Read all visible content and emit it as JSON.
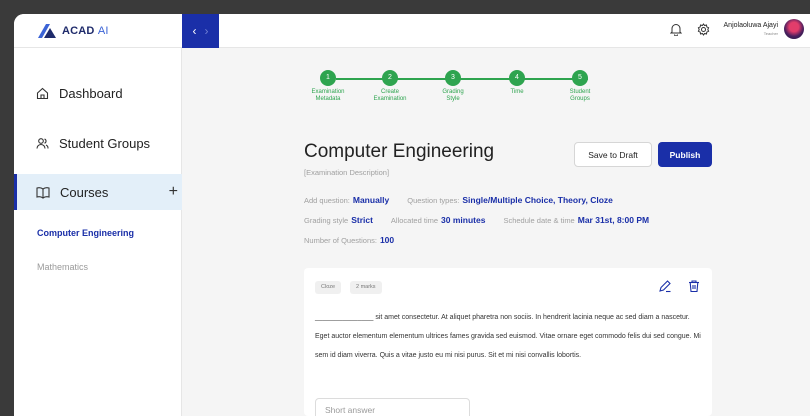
{
  "header": {
    "logo_text": "ACAD",
    "logo_ai": "AI",
    "user_name": "Anjolaoluwa Ajayi",
    "user_role": "Teacher"
  },
  "sidebar": {
    "items": [
      {
        "label": "Dashboard",
        "icon": "home-icon"
      },
      {
        "label": "Student Groups",
        "icon": "users-icon"
      },
      {
        "label": "Courses",
        "icon": "book-icon"
      }
    ],
    "courses": [
      "Computer Engineering",
      "Mathematics"
    ]
  },
  "stepper": [
    {
      "num": "1",
      "label_1": "Examination",
      "label_2": "Metadata"
    },
    {
      "num": "2",
      "label_1": "Create",
      "label_2": "Examination"
    },
    {
      "num": "3",
      "label_1": "Grading",
      "label_2": "Style"
    },
    {
      "num": "4",
      "label_1": "Time",
      "label_2": ""
    },
    {
      "num": "5",
      "label_1": "Student",
      "label_2": "Groups"
    }
  ],
  "exam": {
    "title": "Computer Engineering",
    "description": "[Examination Description]",
    "save_draft": "Save to Draft",
    "publish": "Publish",
    "meta": {
      "add_question_label": "Add question:",
      "add_question_value": "Manually",
      "question_types_label": "Question types:",
      "question_types_value": "Single/Multiple Choice, Theory, Cloze",
      "grading_style_label": "Grading style",
      "grading_style_value": "Strict",
      "allocated_time_label": "Allocated time",
      "allocated_time_value": "30 minutes",
      "schedule_label": "Schedule date & time",
      "schedule_value": "Mar 31st, 8:00 PM",
      "num_questions_label": "Number of Questions:",
      "num_questions_value": "100"
    }
  },
  "question": {
    "type_tag": "Cloze",
    "marks_tag": "2 marks",
    "text": "_______________ sit amet consectetur. At aliquet pharetra non sociis. In hendrerit lacinia neque ac sed diam a nascetur. Eget auctor elementum elementum ultrices fames gravida sed euismod. Vitae ornare eget commodo felis dui sed congue. Mi sem id diam viverra. Quis a vitae justo eu mi nisi purus. Sit et mi nisi convallis lobortis.",
    "answer_placeholder": "Short answer"
  },
  "colors": {
    "primary": "#1a2fa8",
    "step_green": "#2ea44f",
    "active_bg": "#e3eff9"
  }
}
